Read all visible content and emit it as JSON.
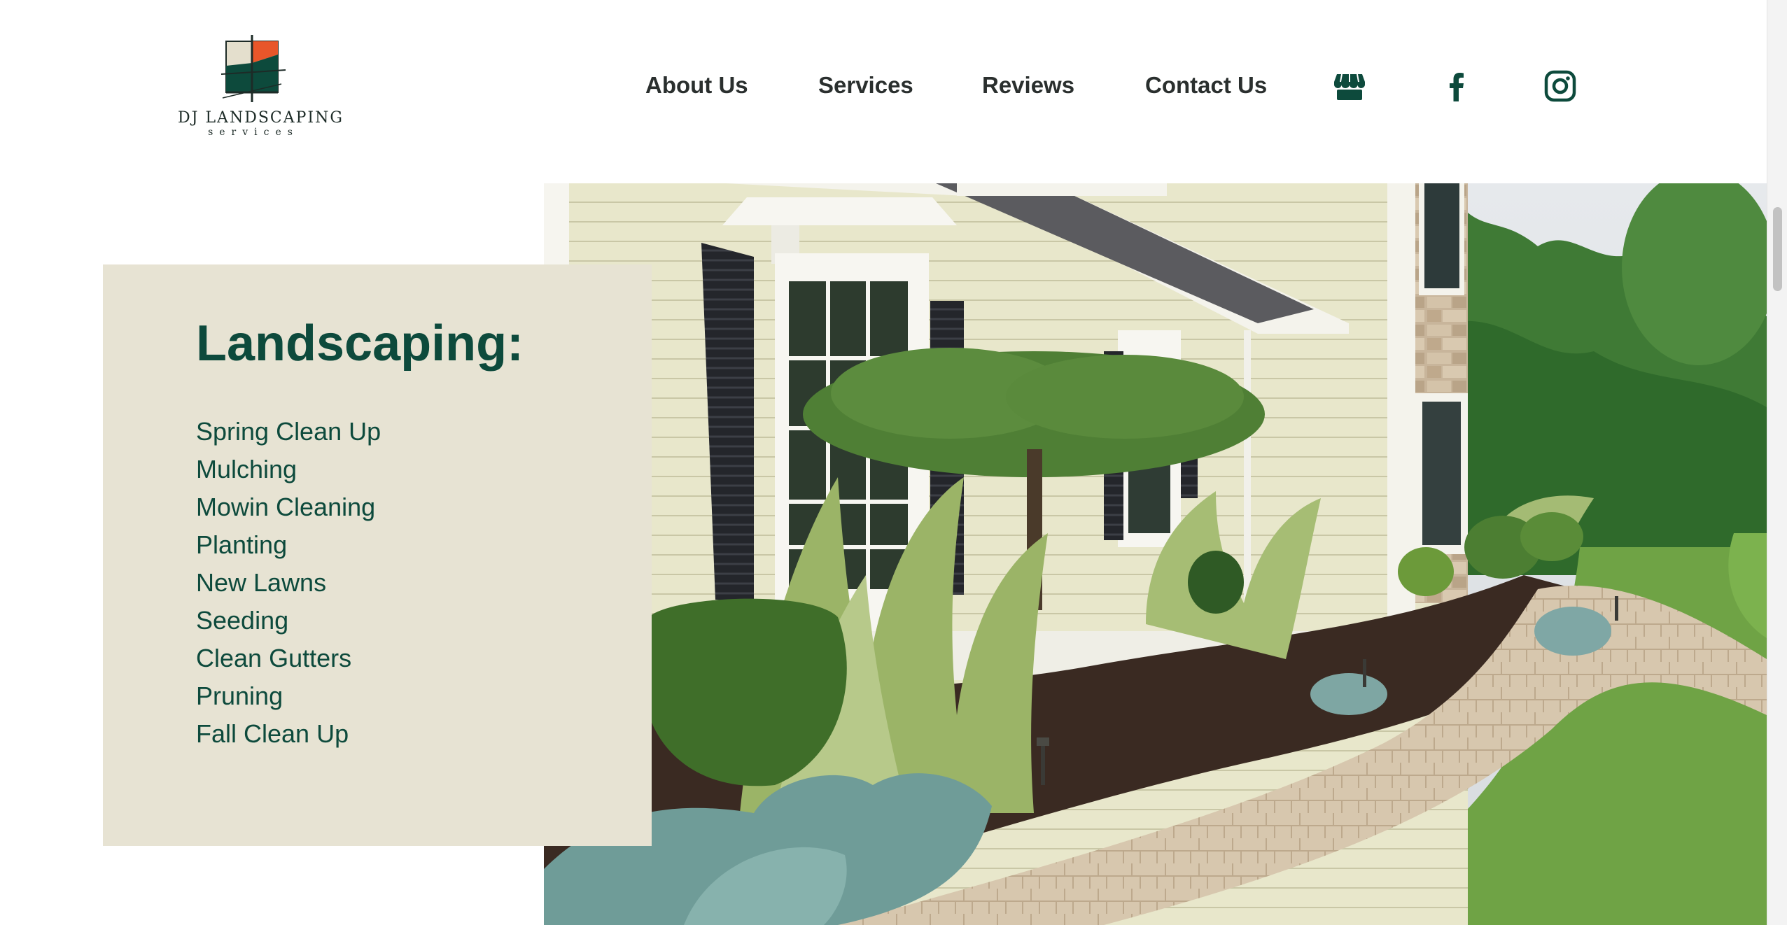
{
  "brand": {
    "name": "DJ LANDSCAPING",
    "tagline": "services"
  },
  "nav": {
    "links": [
      {
        "label": "About Us"
      },
      {
        "label": "Services"
      },
      {
        "label": "Reviews"
      },
      {
        "label": "Contact Us"
      }
    ],
    "icons": [
      "google-business-storefront-icon",
      "facebook-icon",
      "instagram-icon"
    ]
  },
  "services": {
    "title": "Landscaping:",
    "items": [
      "Spring Clean Up",
      "Mulching",
      "Mowin Cleaning",
      "Planting",
      "New Lawns",
      "Seeding",
      "Clean Gutters",
      "Pruning",
      "Fall Clean Up"
    ]
  },
  "colors": {
    "brand_green": "#0d4a3c",
    "panel_beige": "#e7e3d3",
    "nav_text": "#2a2f2e",
    "logo_orange": "#e8562a"
  }
}
